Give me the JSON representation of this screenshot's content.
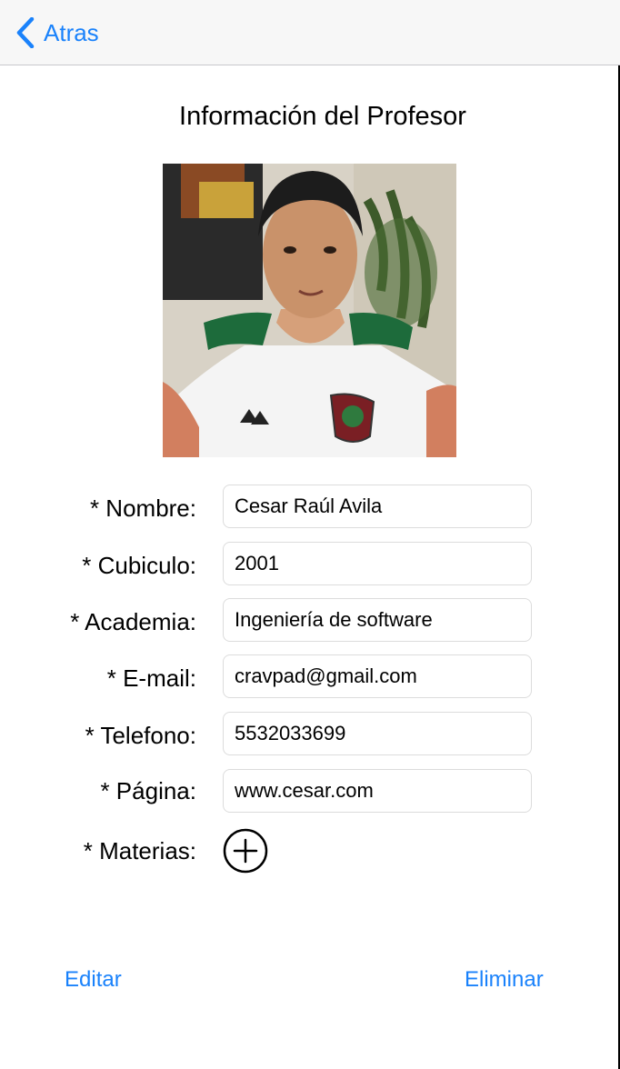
{
  "nav": {
    "back_label": "Atras"
  },
  "title": "Información del Profesor",
  "form": {
    "nombre": {
      "label": "* Nombre:",
      "value": "Cesar Raúl Avila"
    },
    "cubiculo": {
      "label": "* Cubiculo:",
      "value": "2001"
    },
    "academia": {
      "label": "* Academia:",
      "value": "Ingeniería de software"
    },
    "email": {
      "label": "* E-mail:",
      "value": "cravpad@gmail.com"
    },
    "telefono": {
      "label": "* Telefono:",
      "value": "5532033699"
    },
    "pagina": {
      "label": "* Página:",
      "value": "www.cesar.com"
    },
    "materias": {
      "label": "* Materias:"
    }
  },
  "actions": {
    "edit_label": "Editar",
    "delete_label": "Eliminar"
  },
  "icons": {
    "back": "chevron-left-icon",
    "add": "plus-circle-icon"
  },
  "colors": {
    "accent": "#1a82fb",
    "navbar_bg": "#f7f7f7"
  }
}
